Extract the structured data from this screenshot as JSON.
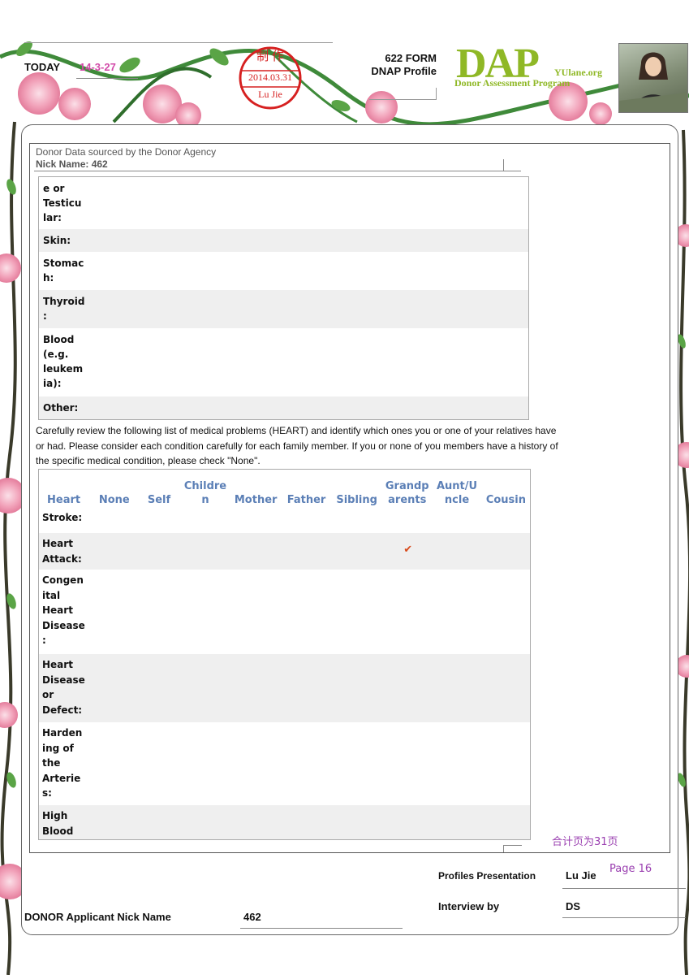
{
  "header": {
    "today_label": "TODAY",
    "today_value": "14-3-27",
    "stamp_top": "制 作",
    "stamp_date": "2014.03.31",
    "stamp_name": "Lu Jie",
    "form_line1": "622 FORM",
    "form_line2": "DNAP Profile",
    "logo_main": "DAP",
    "logo_url": "YUlane.org",
    "logo_sub": "Donor Assessment Program"
  },
  "source": {
    "title": "Donor Data sourced by the Donor Agency",
    "nick": "Nick Name: 462"
  },
  "table1": {
    "rows": [
      {
        "label": "e or Testicu lar:",
        "alt": false
      },
      {
        "label": "Skin:",
        "alt": true
      },
      {
        "label": "Stomac h:",
        "alt": false
      },
      {
        "label": "Thyroid :",
        "alt": true
      },
      {
        "label": "Blood (e.g. leukem ia):",
        "alt": false
      },
      {
        "label": "Other:",
        "alt": true
      }
    ]
  },
  "instruction": "Carefully review the following list of medical problems (HEART) and identify which ones you or one of your relatives have or had. Please consider each condition carefully for each family member. If you or none of you members have a history of the specific medical condition, please check \"None\".",
  "table2": {
    "headers": [
      "Heart",
      "None",
      "Self",
      "Childre n",
      "Mother",
      "Father",
      "Sibling",
      "Grandp arents",
      "Aunt/U ncle",
      "Cousin"
    ],
    "rows": [
      {
        "label": "Stroke:",
        "alt": false,
        "check_col": -1
      },
      {
        "label": "Heart Attack:",
        "alt": true,
        "check_col": 7
      },
      {
        "label": "Congen ital Heart Disease :",
        "alt": false,
        "check_col": -1
      },
      {
        "label": "Heart Disease or Defect:",
        "alt": true,
        "check_col": -1
      },
      {
        "label": "Harden ing of the Arterie s:",
        "alt": false,
        "check_col": -1
      },
      {
        "label": "High Blood",
        "alt": true,
        "check_col": -1
      }
    ],
    "check_glyph": "✔"
  },
  "page_count_cn": "合计页为31页",
  "footer": {
    "presentation_label": "Profiles Presentation",
    "presenter": "Lu Jie",
    "page": "Page 16",
    "interview_label": "Interview by",
    "interviewer": "DS",
    "applicant_label": "DONOR Applicant Nick Name",
    "applicant_value": "462"
  },
  "colors": {
    "header_blue": "#5b7fb6",
    "logo_green": "#8fb826",
    "stamp_red": "#d62020",
    "today_pink": "#d24aa8",
    "check_orange": "#d84a1b"
  }
}
